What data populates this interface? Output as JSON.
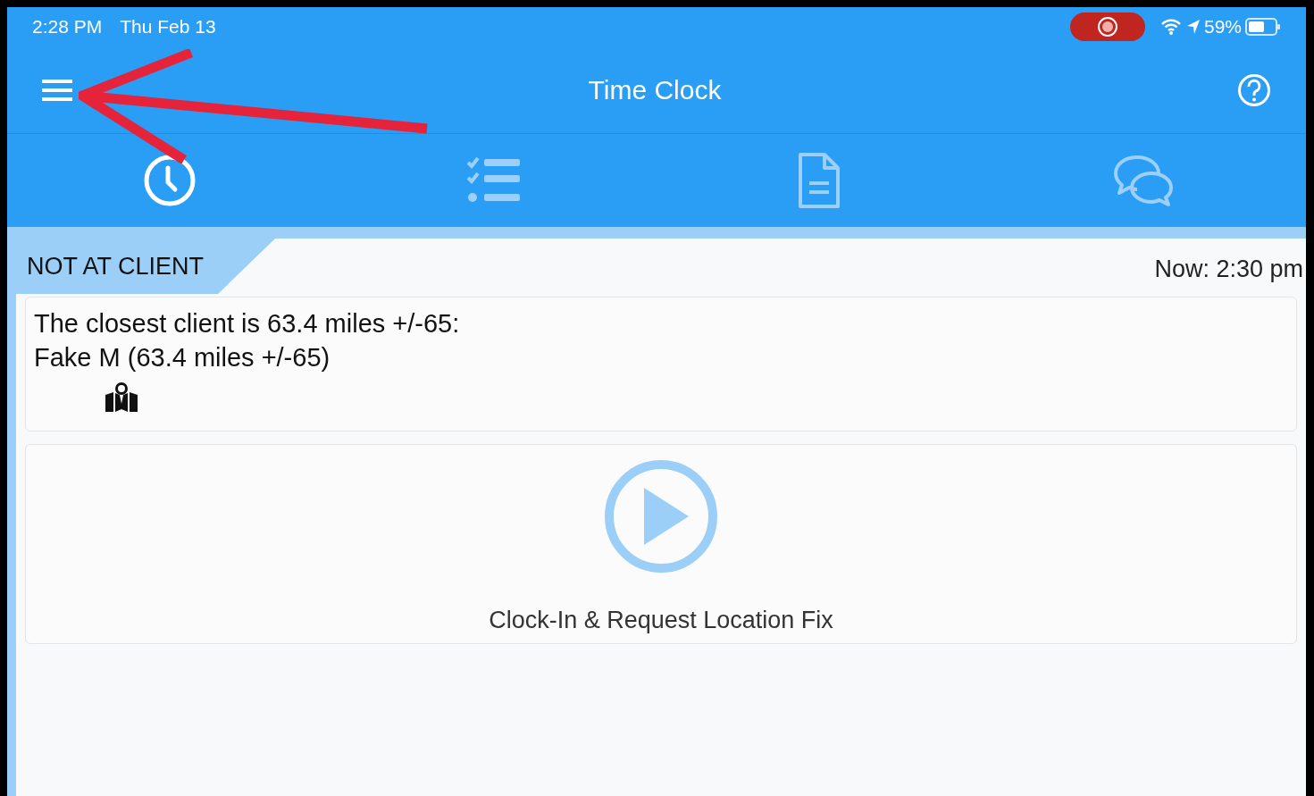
{
  "status_bar": {
    "time": "2:28 PM",
    "date": "Thu Feb 13",
    "battery": "59%"
  },
  "header": {
    "title": "Time Clock"
  },
  "tabs": [
    {
      "selected": true
    },
    {
      "selected": false
    },
    {
      "selected": false
    },
    {
      "selected": false
    }
  ],
  "banner": {
    "status": "NOT AT CLIENT",
    "now": "Now: 2:30 pm"
  },
  "closest_client": {
    "lines": [
      "The closest client is 63.4 miles +/-65:",
      "Fake M (63.4 miles +/-65)"
    ]
  },
  "clock_in": {
    "label": "Clock-In & Request Location Fix"
  }
}
